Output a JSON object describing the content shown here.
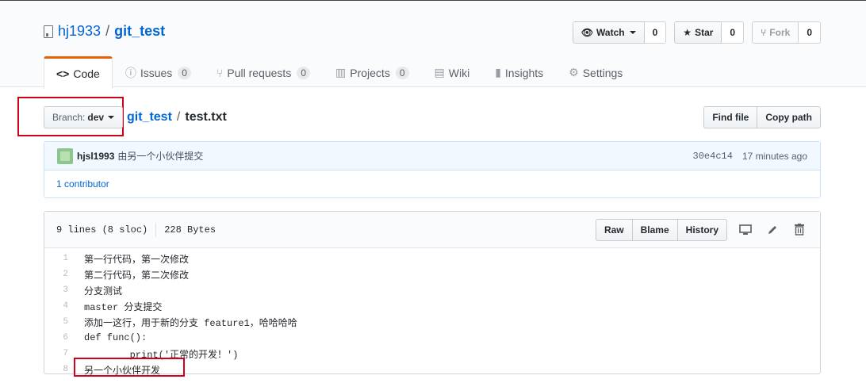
{
  "repo": {
    "owner": "hj1933",
    "separator": "/",
    "name": "git_test"
  },
  "actions": {
    "watch": {
      "label": "Watch",
      "count": "0"
    },
    "star": {
      "label": "Star",
      "count": "0"
    },
    "fork": {
      "label": "Fork",
      "count": "0"
    }
  },
  "nav": [
    {
      "label": "Code",
      "icon": "code-icon",
      "glyph": "<>"
    },
    {
      "label": "Issues",
      "icon": "issue-icon",
      "glyph": "ⓘ",
      "count": "0"
    },
    {
      "label": "Pull requests",
      "icon": "pull-request-icon",
      "glyph": "⑂",
      "count": "0"
    },
    {
      "label": "Projects",
      "icon": "project-icon",
      "glyph": "▥",
      "count": "0"
    },
    {
      "label": "Wiki",
      "icon": "book-icon",
      "glyph": "▤"
    },
    {
      "label": "Insights",
      "icon": "graph-icon",
      "glyph": "▮"
    },
    {
      "label": "Settings",
      "icon": "gear-icon",
      "glyph": "⚙"
    }
  ],
  "branch": {
    "label": "Branch:",
    "value": "dev"
  },
  "breadcrumb": {
    "root": "git_test",
    "separator": "/",
    "file": "test.txt"
  },
  "file_nav": {
    "find_file": "Find file",
    "copy_path": "Copy path"
  },
  "commit": {
    "author": "hjsl1993",
    "message": "由另一个小伙伴提交",
    "sha": "30e4c14",
    "time": "17 minutes ago",
    "contributors": "1 contributor"
  },
  "file": {
    "lines_info": "9 lines (8 sloc)",
    "size": "228 Bytes",
    "raw": "Raw",
    "blame": "Blame",
    "history": "History",
    "lines": [
      {
        "num": "1",
        "text": "第一行代码，第一次修改"
      },
      {
        "num": "2",
        "text": "第二行代码，第二次修改"
      },
      {
        "num": "3",
        "text": "分支测试"
      },
      {
        "num": "4",
        "text": "master 分支提交"
      },
      {
        "num": "5",
        "text": "添加一这行，用于新的分支 feature1，哈哈哈哈"
      },
      {
        "num": "6",
        "text": "def func():"
      },
      {
        "num": "7",
        "text": "        print('正常的开发！')"
      },
      {
        "num": "8",
        "text": "另一个小伙伴开发"
      }
    ]
  },
  "colors": {
    "accent": "#e36209",
    "link": "#0366d6",
    "highlight": "#d0021b"
  }
}
